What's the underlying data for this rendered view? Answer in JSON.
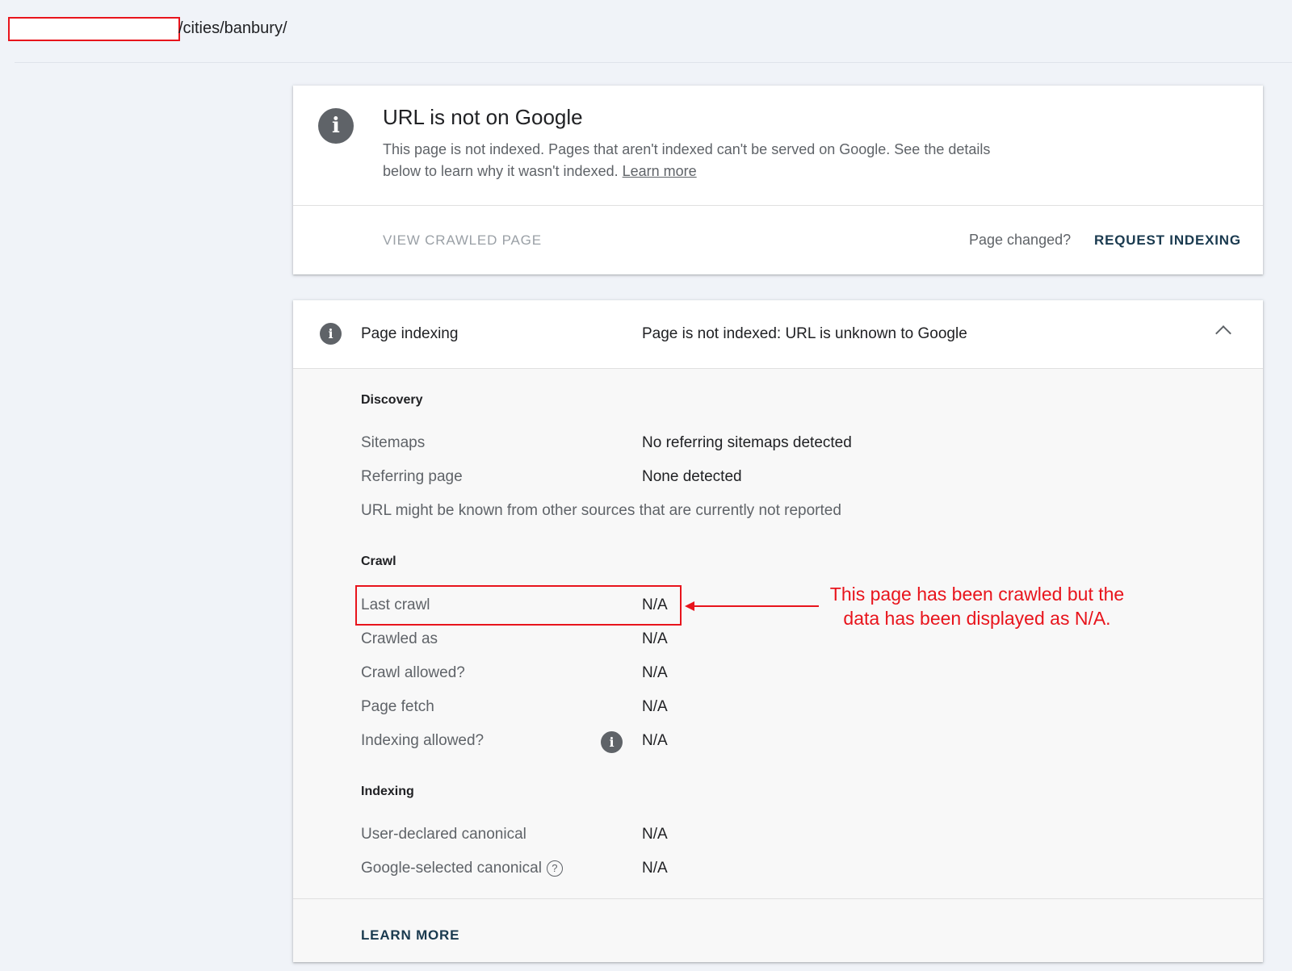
{
  "breadcrumb": {
    "path": "/cities/banbury/"
  },
  "status_card": {
    "title": "URL is not on Google",
    "description": "This page is not indexed. Pages that aren't indexed can't be served on Google. See the details below to learn why it wasn't indexed.",
    "learn_more_link": "Learn more",
    "view_crawled_page": "VIEW CRAWLED PAGE",
    "page_changed": "Page changed?",
    "request_indexing": "REQUEST INDEXING"
  },
  "indexing_card": {
    "label": "Page indexing",
    "value": "Page is not indexed: URL is unknown to Google",
    "discovery": {
      "title": "Discovery",
      "rows": [
        {
          "label": "Sitemaps",
          "value": "No referring sitemaps detected"
        },
        {
          "label": "Referring page",
          "value": "None detected"
        }
      ],
      "note": "URL might be known from other sources that are currently not reported"
    },
    "crawl": {
      "title": "Crawl",
      "rows": [
        {
          "label": "Last crawl",
          "value": "N/A"
        },
        {
          "label": "Crawled as",
          "value": "N/A"
        },
        {
          "label": "Crawl allowed?",
          "value": "N/A"
        },
        {
          "label": "Page fetch",
          "value": "N/A"
        },
        {
          "label": "Indexing allowed?",
          "value": "N/A"
        }
      ]
    },
    "indexing": {
      "title": "Indexing",
      "rows": [
        {
          "label": "User-declared canonical",
          "value": "N/A"
        },
        {
          "label": "Google-selected canonical",
          "value": "N/A"
        }
      ]
    },
    "learn_more_button": "LEARN MORE"
  },
  "annotation": {
    "text": "This page has been crawled but the data has been displayed as N/A.",
    "color": "#e8141c"
  },
  "icons": {
    "status": "info-icon",
    "section": "info-icon",
    "collapse": "chevron-up-icon",
    "help": "help-circle-icon"
  },
  "colors": {
    "accent": "#1a3a4f",
    "muted": "#5f6368",
    "background": "#f0f3f8"
  }
}
